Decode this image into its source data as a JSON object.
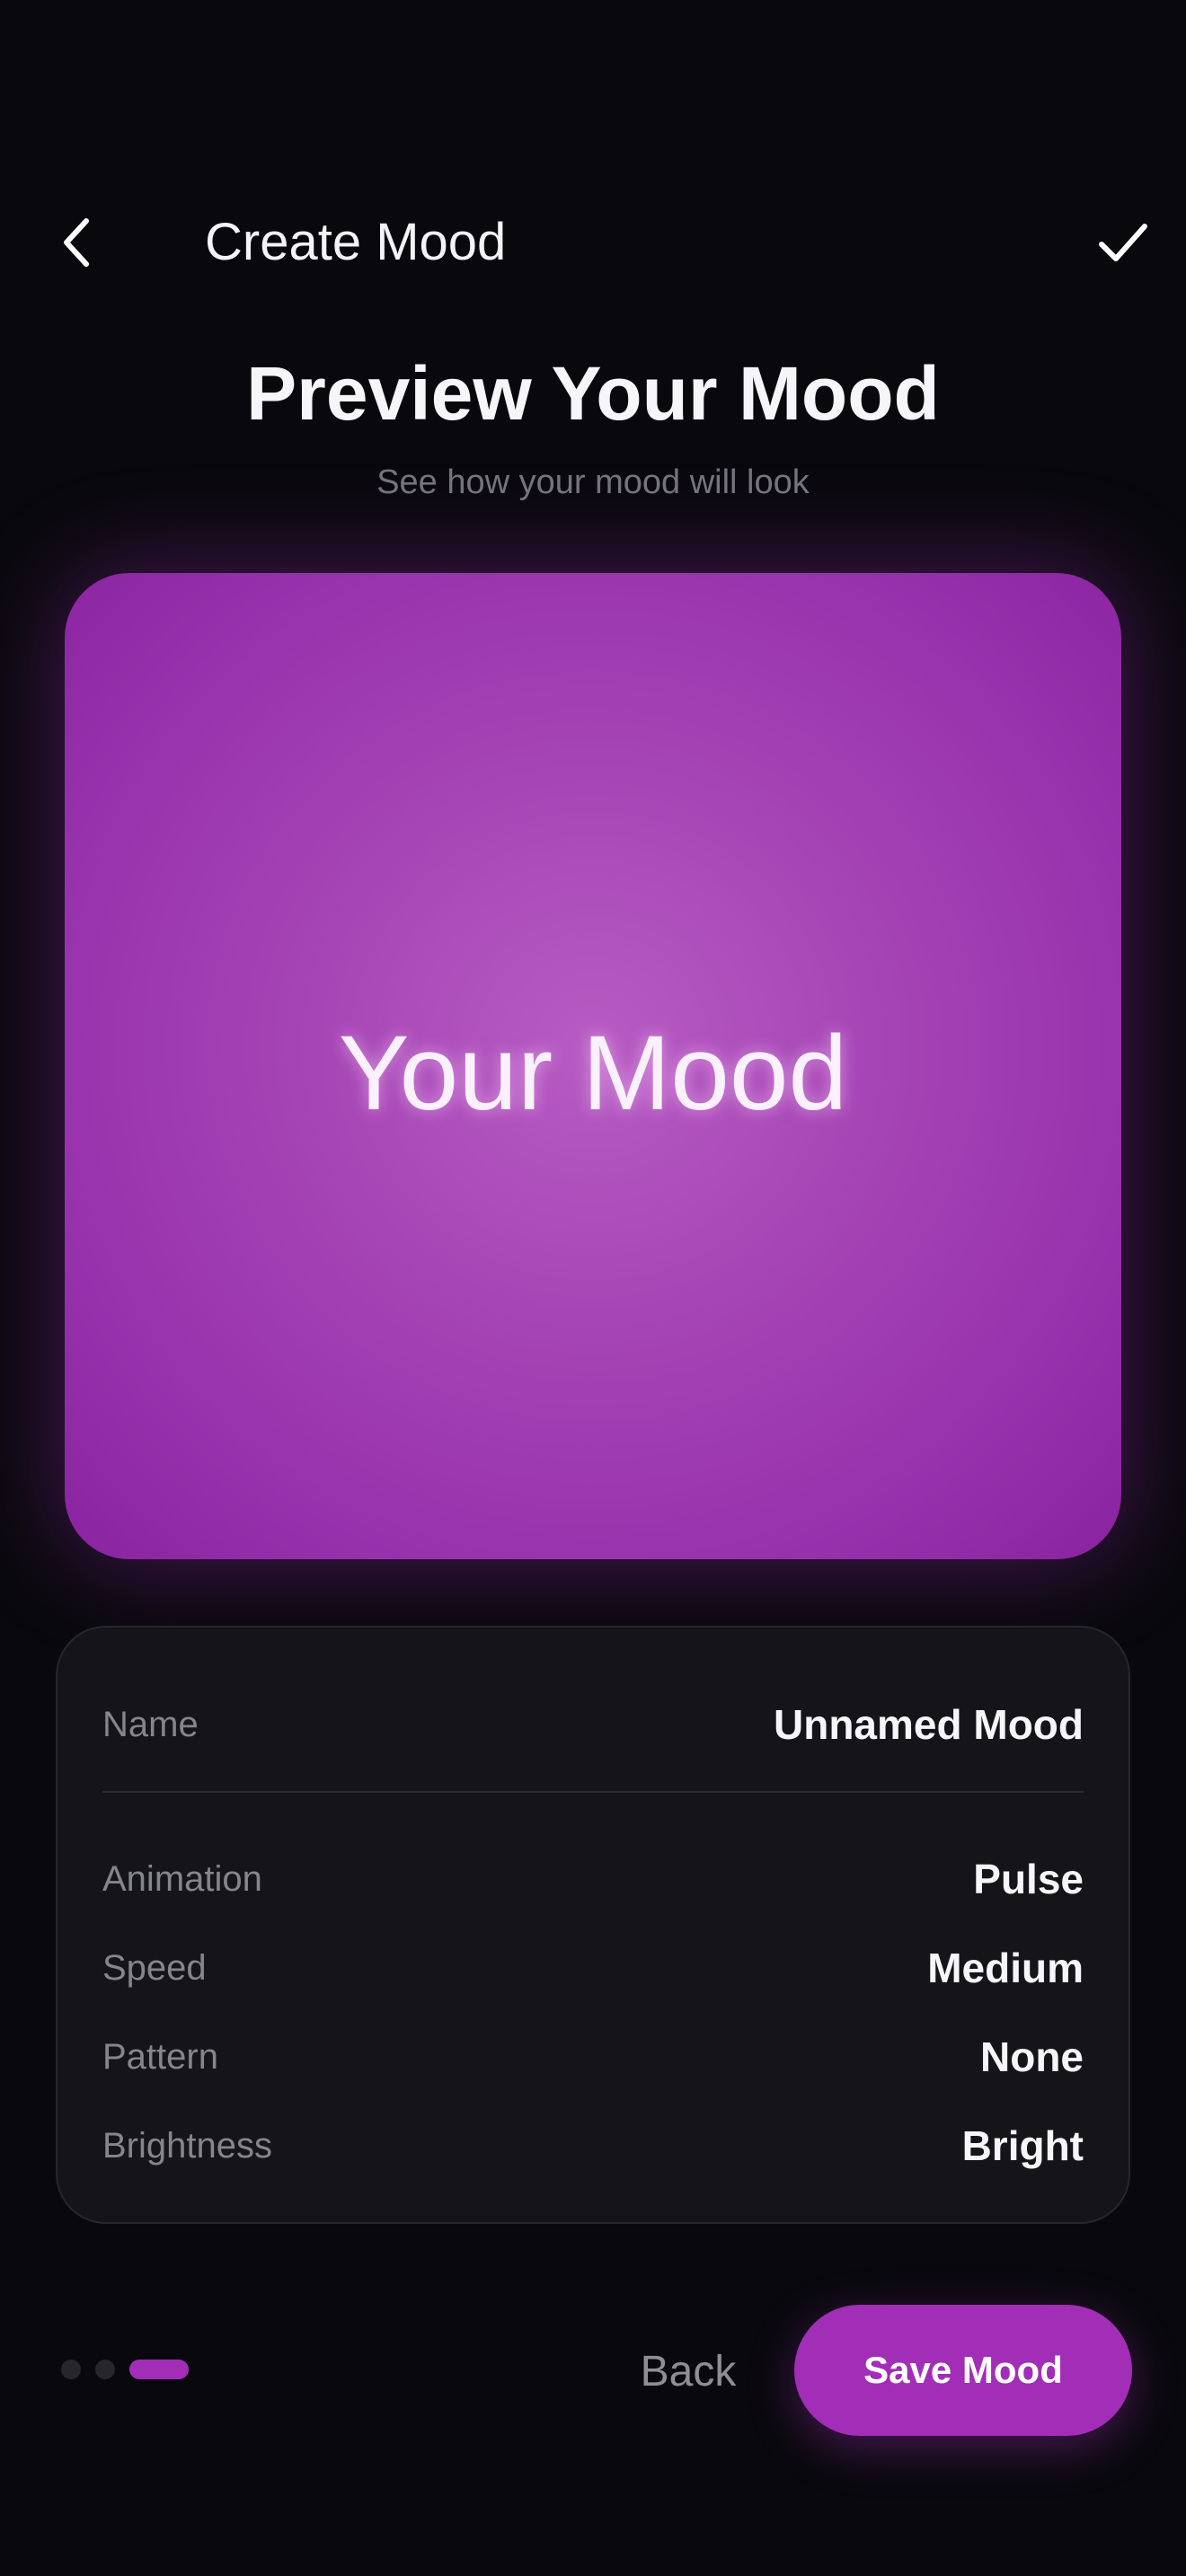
{
  "header": {
    "title": "Create Mood",
    "back_icon": "chevron-left-icon",
    "done_icon": "checkmark-icon"
  },
  "page": {
    "title": "Preview Your Mood",
    "subtitle": "See how your mood will look"
  },
  "preview": {
    "text": "Your Mood",
    "color": "#a544b5"
  },
  "details": {
    "name": {
      "label": "Name",
      "value": "Unnamed Mood"
    },
    "rows": [
      {
        "label": "Animation",
        "value": "Pulse"
      },
      {
        "label": "Speed",
        "value": "Medium"
      },
      {
        "label": "Pattern",
        "value": "None"
      },
      {
        "label": "Brightness",
        "value": "Bright"
      }
    ]
  },
  "pagination": {
    "total_steps": 3,
    "current_step": 3
  },
  "footer": {
    "back_label": "Back",
    "save_label": "Save Mood"
  },
  "colors": {
    "accent": "#a22eb8",
    "background": "#09090d",
    "card": "#151519"
  }
}
